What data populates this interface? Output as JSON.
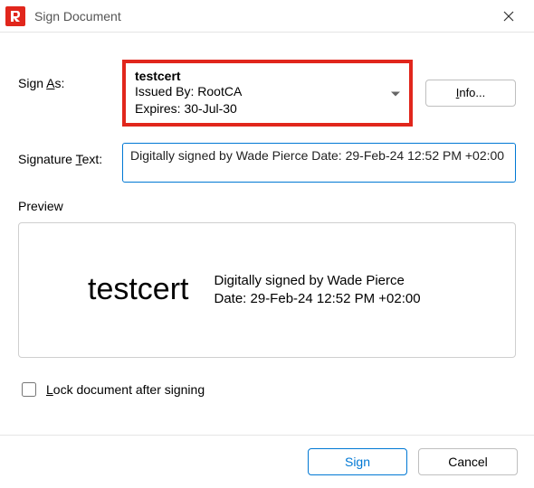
{
  "window": {
    "title": "Sign Document"
  },
  "labels": {
    "sign_as": "Sign As:",
    "signature_text": "Signature Text:",
    "preview": "Preview",
    "lock": "Lock document after signing",
    "info": "Info...",
    "sign": "Sign",
    "cancel": "Cancel"
  },
  "certificate": {
    "name": "testcert",
    "issued_by_label": "Issued By:",
    "issued_by": "RootCA",
    "expires_label": "Expires:",
    "expires": "30-Jul-30"
  },
  "signature_text": "Digitally signed by Wade Pierce Date: 29-Feb-24 12:52 PM +02:00",
  "preview": {
    "cert_name": "testcert",
    "line1": "Digitally signed by Wade Pierce",
    "line2": "Date: 29-Feb-24 12:52 PM +02:00"
  },
  "lock_checked": false,
  "colors": {
    "accent_red": "#e1261c",
    "accent_blue": "#0078d4"
  }
}
